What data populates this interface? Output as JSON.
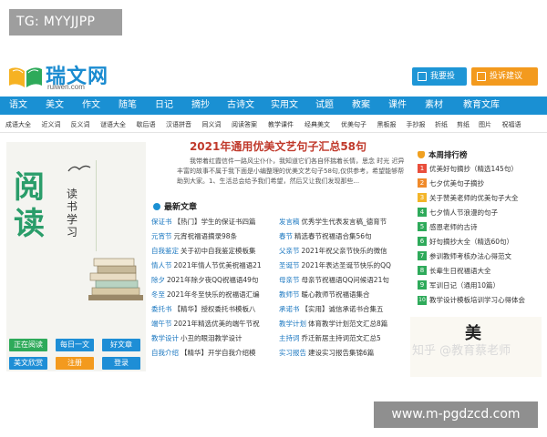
{
  "overlay": {
    "top_tag": "TG: MYYJJPP",
    "bottom_tag": "www.m-pgdzcd.com"
  },
  "header": {
    "logo_text": "瑞文网",
    "logo_sub": "ruiwen.com",
    "buttons": [
      {
        "label": "我要投稿",
        "color": "#1e96d6"
      },
      {
        "label": "投诉建议",
        "color": "#f39a1e"
      }
    ]
  },
  "nav": [
    "语文",
    "美文",
    "作文",
    "随笔",
    "日记",
    "摘抄",
    "古诗文",
    "实用文",
    "试题",
    "教案",
    "课件",
    "素材",
    "教育文库"
  ],
  "subnav": [
    "成语大全",
    "近义词",
    "反义词",
    "谜语大全",
    "歇后语",
    "汉语拼音",
    "同义词",
    "阅读答案",
    "教学课件",
    "经典美文",
    "优美句子",
    "黑板报",
    "手抄报",
    "折纸",
    "剪纸",
    "图片",
    "祝福语"
  ],
  "promo": {
    "big_chars": [
      "阅",
      "读"
    ],
    "book_title": "读书学习",
    "buttons": [
      {
        "label": "正在阅读",
        "color": "#2eaa5a"
      },
      {
        "label": "每日一文",
        "color": "#1e8ed6"
      },
      {
        "label": "好文章",
        "color": "#1e8ed6"
      },
      {
        "label": "美文欣赏",
        "color": "#1e8ed6"
      },
      {
        "label": "注册",
        "color": "#f39a1e"
      },
      {
        "label": "登录",
        "color": "#1e8ed6"
      }
    ]
  },
  "article": {
    "title": "2021年通用优美文艺句子汇总58句",
    "desc": "我带着红霞信件一路风尘仆仆，我知道它们各自怀揣着长情，思念 时光 迟异丰富的故事不属于我下面是小编整理的优美文艺句子58句,仅供参考，希望能够帮助到大家。1、生活总会给予我们希望，然后又让我们发现那些..."
  },
  "latest": {
    "heading": "最新文章",
    "col1": [
      {
        "tag": "保证书",
        "text": "【热门】学生的保证书四篇"
      },
      {
        "tag": "元宵节",
        "text": "元宵祝福语摘录98条"
      },
      {
        "tag": "自我鉴定",
        "text": "关于初中自我鉴定模板集"
      },
      {
        "tag": "情人节",
        "text": "2021年情人节优美祝福语21"
      },
      {
        "tag": "除夕",
        "text": "2021年除夕夜QQ祝福语49句"
      },
      {
        "tag": "冬至",
        "text": "2021年冬至快乐的祝福语汇编"
      },
      {
        "tag": "委托书",
        "text": "【精华】授权委托书模板八"
      },
      {
        "tag": "端午节",
        "text": "2021年精选优美的端午节祝"
      },
      {
        "tag": "教学设计",
        "text": "小丑的眼泪教学设计"
      },
      {
        "tag": "自我介绍",
        "text": "【精华】开学自我介绍模"
      }
    ],
    "col2": [
      {
        "tag": "发言稿",
        "text": "优秀学生代表发言稿_德育节"
      },
      {
        "tag": "春节",
        "text": "精选春节祝福语合集56句"
      },
      {
        "tag": "父亲节",
        "text": "2021年祝父亲节快乐的微信"
      },
      {
        "tag": "圣诞节",
        "text": "2021年表达圣诞节快乐的QQ"
      },
      {
        "tag": "母亲节",
        "text": "母亲节祝福语QQ问候语21句"
      },
      {
        "tag": "教师节",
        "text": "暖心教师节祝福语集合"
      },
      {
        "tag": "承诺书",
        "text": "【实用】诚信承诺书合集五"
      },
      {
        "tag": "教学计划",
        "text": "体育教学计划范文汇总8篇"
      },
      {
        "tag": "主持词",
        "text": "乔迁新居主持词范文汇总5"
      },
      {
        "tag": "实习报告",
        "text": "建设实习报告集锦6篇"
      }
    ]
  },
  "ranking": {
    "heading": "本周排行榜",
    "items": [
      {
        "num": "1",
        "text": "优美好句摘抄（精选145句）",
        "color": "#e94e3c"
      },
      {
        "num": "2",
        "text": "七夕优美句子摘抄",
        "color": "#f08a2a"
      },
      {
        "num": "3",
        "text": "关于赞美老师的优美句子大全",
        "color": "#f3b52a"
      },
      {
        "num": "4",
        "text": "七夕情人节浪漫的句子",
        "color": "#2eaa5a"
      },
      {
        "num": "5",
        "text": "感恩老师的古诗",
        "color": "#2eaa5a"
      },
      {
        "num": "6",
        "text": "好句摘抄大全（精选60句）",
        "color": "#2eaa5a"
      },
      {
        "num": "7",
        "text": "参训教师考核办法心得范文",
        "color": "#2eaa5a"
      },
      {
        "num": "8",
        "text": "长辈生日祝福语大全",
        "color": "#2eaa5a"
      },
      {
        "num": "9",
        "text": "军训日记（通用10篇）",
        "color": "#2eaa5a"
      },
      {
        "num": "10",
        "text": "教学设计模板培训学习心得体会",
        "color": "#2eaa5a"
      }
    ]
  },
  "callig": {
    "big_char": "美",
    "zhihu_note": "知乎 @教育蔡老师"
  }
}
